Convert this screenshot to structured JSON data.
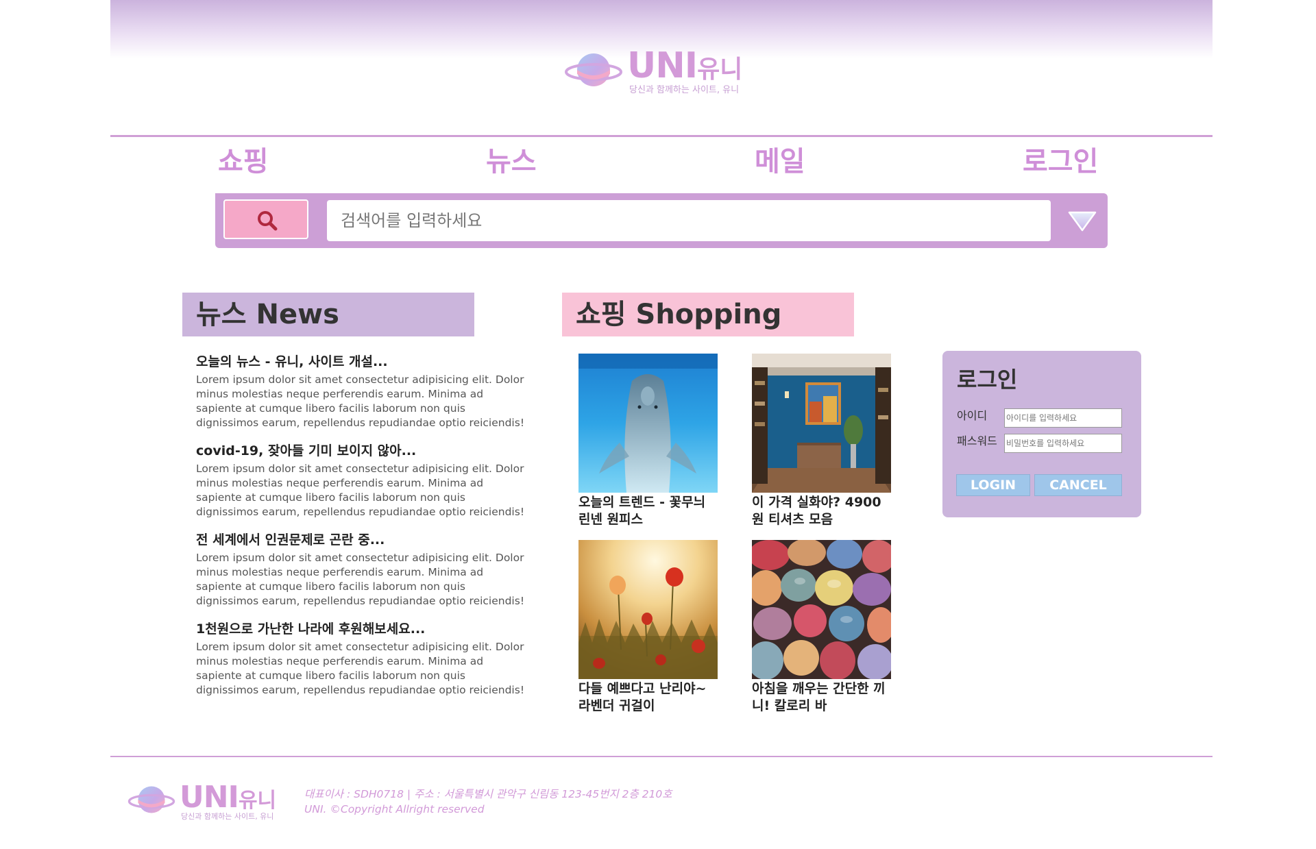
{
  "brand": {
    "name": "UNI",
    "name_kr": "유니",
    "tagline": "당신과 함께하는 사이트, 유니",
    "accent_color": "#cf9fd6",
    "pink_color": "#f9c3d7"
  },
  "nav": {
    "items": [
      {
        "label": "쇼핑"
      },
      {
        "label": "뉴스"
      },
      {
        "label": "메일"
      },
      {
        "label": "로그인"
      }
    ]
  },
  "search": {
    "placeholder": "검색어를 입력하세요",
    "button_icon": "search-icon",
    "dropdown_icon": "triangle-down-icon"
  },
  "news": {
    "heading": "뉴스 News",
    "items": [
      {
        "title": "오늘의 뉴스 - 유니, 사이트 개설...",
        "body": "Lorem ipsum dolor sit amet consectetur adipisicing elit. Dolor minus molestias neque perferendis earum. Minima ad sapiente at cumque libero facilis laborum non quis dignissimos earum, repellendus repudiandae optio reiciendis!"
      },
      {
        "title": "covid-19, 잦아들 기미 보이지 않아...",
        "body": "Lorem ipsum dolor sit amet consectetur adipisicing elit. Dolor minus molestias neque perferendis earum. Minima ad sapiente at cumque libero facilis laborum non quis dignissimos earum, repellendus repudiandae optio reiciendis!"
      },
      {
        "title": "전 세계에서 인권문제로 곤란 중...",
        "body": "Lorem ipsum dolor sit amet consectetur adipisicing elit. Dolor minus molestias neque perferendis earum. Minima ad sapiente at cumque libero facilis laborum non quis dignissimos earum, repellendus repudiandae optio reiciendis!"
      },
      {
        "title": "1천원으로 가난한 나라에 후원해보세요...",
        "body": "Lorem ipsum dolor sit amet consectetur adipisicing elit. Dolor minus molestias neque perferendis earum. Minima ad sapiente at cumque libero facilis laborum non quis dignissimos earum, repellendus repudiandae optio reiciendis!"
      }
    ]
  },
  "shopping": {
    "heading": "쇼핑 Shopping",
    "products": [
      {
        "caption": "오늘의 트렌드 - 꽃무늬 린넨 원피스",
        "image": "dolphin-photo"
      },
      {
        "caption": "이 가격 실화야? 4900원 티셔츠 모음",
        "image": "blue-room-photo"
      },
      {
        "caption": "다들 예쁘다고 난리야~ 라벤더 귀걸이",
        "image": "poppy-field-photo"
      },
      {
        "caption": "아침을 깨우는 간단한 끼니! 칼로리 바",
        "image": "colorful-stones-photo"
      }
    ]
  },
  "login": {
    "title": "로그인",
    "id_label": "아이디",
    "id_placeholder": "아이디를 입력하세요",
    "pw_label": "패스워드",
    "pw_placeholder": "비밀번호를 입력하세요",
    "login_button": "LOGIN",
    "cancel_button": "CANCEL"
  },
  "footer": {
    "line1": "대표이사 : SDH0718 | 주소 : 서울특별시 관악구 신림동 123-45번지 2층 210호",
    "line2": "UNI. ©Copyright Allright reserved"
  }
}
